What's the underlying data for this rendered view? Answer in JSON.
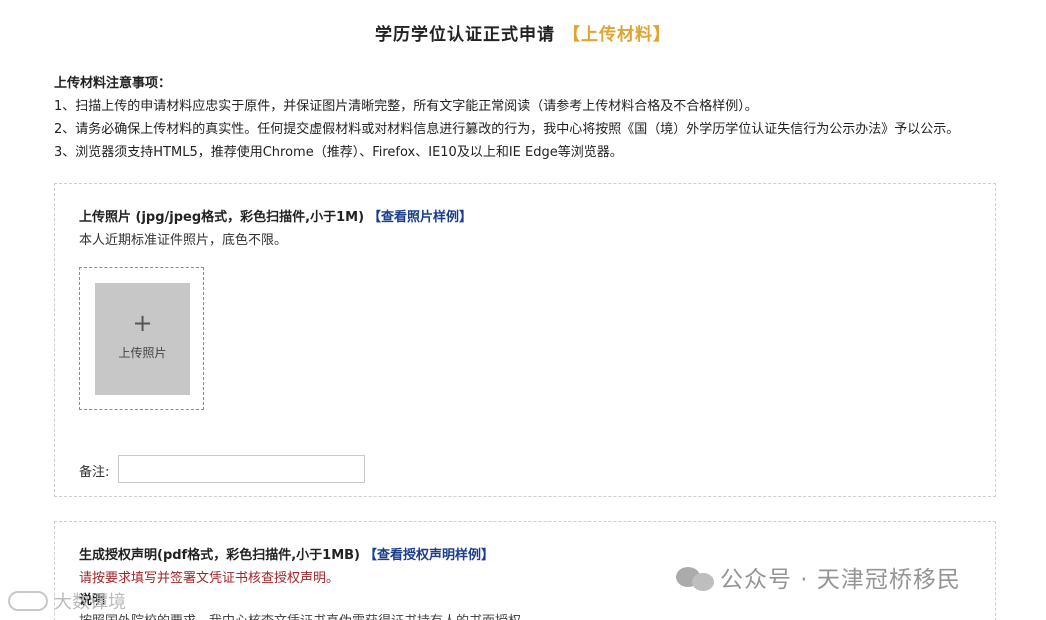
{
  "header": {
    "title": "学历学位认证正式申请",
    "tag": "【上传材料】"
  },
  "notes": {
    "heading": "上传材料注意事项：",
    "items": [
      "1、扫描上传的申请材料应忠实于原件，并保证图片清晰完整，所有文字能正常阅读（请参考上传材料合格及不合格样例）。",
      "2、请务必确保上传材料的真实性。任何提交虚假材料或对材料信息进行篡改的行为，我中心将按照《国（境）外学历学位认证失信行为公示办法》予以公示。",
      "3、浏览器须支持HTML5，推荐使用Chrome（推荐）、Firefox、IE10及以上和IE Edge等浏览器。"
    ]
  },
  "photo_section": {
    "heading": "上传照片 (jpg/jpeg格式，彩色扫描件,小于1M)",
    "sample_link": "【查看照片样例】",
    "description": "本人近期标准证件照片，底色不限。",
    "upload_plus": "+",
    "upload_label": "上传照片",
    "remark_label": "备注:",
    "remark_value": ""
  },
  "auth_section": {
    "heading": "生成授权声明(pdf格式，彩色扫描件,小于1MB)",
    "sample_link": "【查看授权声明样例】",
    "warning": "请按要求填写并签署文凭证书核查授权声明。",
    "sub_heading": "说明",
    "sub_text": "按照国外院校的要求，我中心核查文凭证书真伪需获得证书持有人的书面授权。"
  },
  "watermarks": {
    "right_text": "公众号 · 天津冠桥移民",
    "left_text": "大数谭境"
  },
  "colors": {
    "tag": "#e0a431",
    "link": "#1a3e8c",
    "warning": "#a1262b",
    "upload_box": "#c7c7c7"
  }
}
